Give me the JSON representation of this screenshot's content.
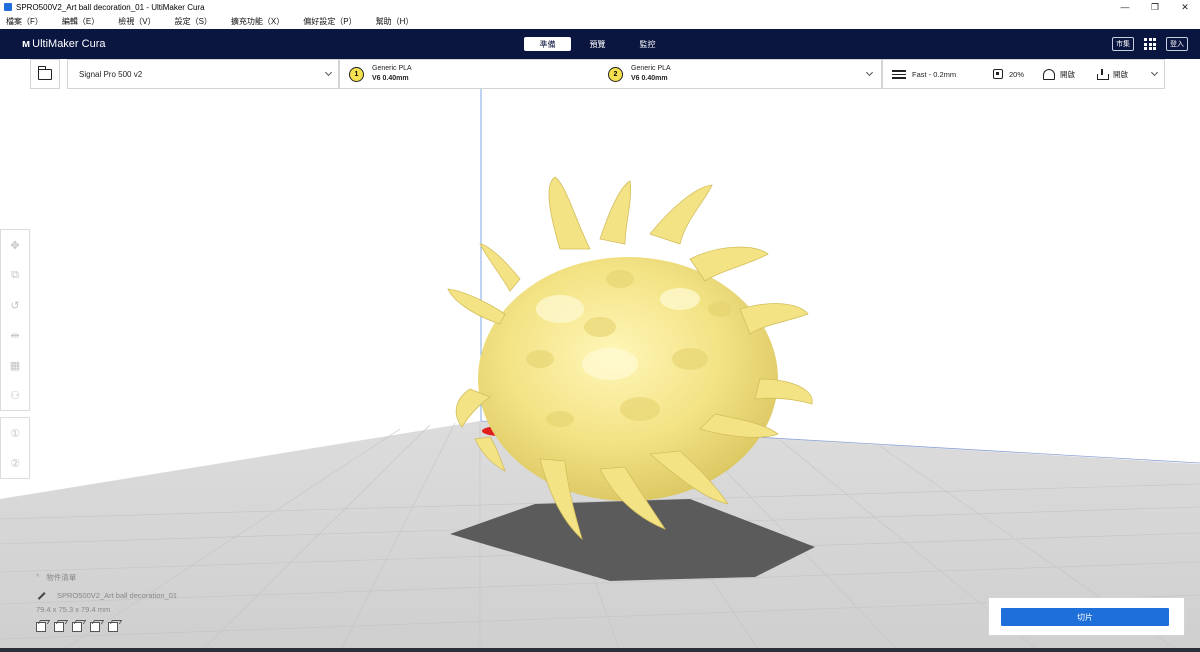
{
  "window": {
    "title": "SPRO500V2_Art ball decoration_01 - UltiMaker Cura",
    "controls": [
      "—",
      "❐",
      "✕"
    ]
  },
  "menu": [
    "檔案（F）",
    "編輯（E）",
    "檢視（V）",
    "設定（S）",
    "擴充功能（X）",
    "偏好設定（P）",
    "幫助（H）"
  ],
  "header": {
    "logo": "UltiMaker Cura",
    "tabs": [
      {
        "label": "準備",
        "active": true
      },
      {
        "label": "預覽",
        "active": false
      },
      {
        "label": "監控",
        "active": false
      }
    ],
    "marketplace": "市集",
    "signin": "登入"
  },
  "toolbar": {
    "printer": "Signal Pro 500 v2",
    "extruder1": {
      "number": "1",
      "material": "Generic PLA",
      "core": "V6 0.40mm"
    },
    "extruder2": {
      "number": "2",
      "material": "Generic PLA",
      "core": "V6 0.40mm"
    },
    "profile": "Fast - 0.2mm",
    "infill": "20%",
    "support": "開啟",
    "adhesion": "開啟"
  },
  "objects": {
    "header": "物件清單",
    "name": "SPRO500V2_Art ball decoration_01",
    "dimensions": "79.4 x 75.3 x 79.4 mm"
  },
  "slice_button": "切片",
  "colors": {
    "header_bg": "#0b1640",
    "accent": "#1e6fd9",
    "model": "#f6ea8c",
    "buildplate": "#d9d9d9",
    "shadow": "#5a5a5a",
    "overhang": "#e0201c"
  }
}
